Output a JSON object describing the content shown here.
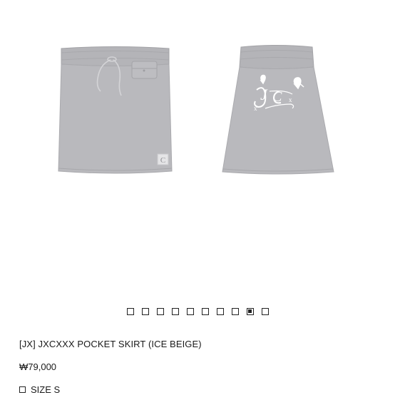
{
  "gallery": {
    "image_count": 10,
    "active_index": 8,
    "front_view_icon": "skirt-front-drawstring-pocket",
    "back_view_icon": "skirt-back-jcx-logo",
    "skirt_color": "#b9b9bc",
    "logo_text": "JCX"
  },
  "product": {
    "title": "[JX] JXCXXX POCKET SKIRT (ICE BEIGE)",
    "price": "₩79,000",
    "option_label": "SIZE S"
  }
}
